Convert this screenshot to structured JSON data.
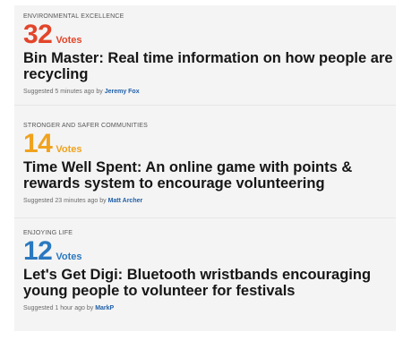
{
  "colors": {
    "card1_votes": "#e2452a",
    "card2_votes": "#f0a21e",
    "card3_votes": "#2a78bf",
    "author_link": "#1f5fa8"
  },
  "ideas": [
    {
      "category": "ENVIRONMENTAL EXCELLENCE",
      "votes": "32",
      "votes_label": "Votes",
      "title": "Bin Master: Real time information on how people are recycling",
      "suggested_prefix": "Suggested 5 minutes ago by",
      "author": "Jeremy Fox"
    },
    {
      "category": "STRONGER AND SAFER COMMUNITIES",
      "votes": "14",
      "votes_label": "Votes",
      "title": "Time Well Spent: An online game with points & rewards system to encourage volunteering",
      "suggested_prefix": "Suggested 23 minutes ago by",
      "author": "Matt Archer"
    },
    {
      "category": "ENJOYING LIFE",
      "votes": "12",
      "votes_label": "Votes",
      "title": "Let's Get Digi: Bluetooth wristbands encouraging young people to volunteer for festivals",
      "suggested_prefix": "Suggested 1 hour ago by",
      "author": "MarkP"
    }
  ]
}
